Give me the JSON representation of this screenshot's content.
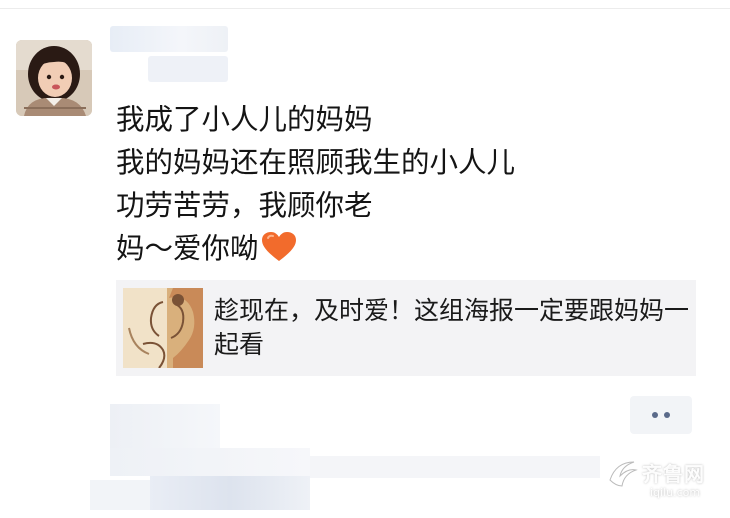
{
  "post": {
    "lines": [
      "我成了小人儿的妈妈",
      "我的妈妈还在照顾我生的小人儿",
      "功劳苦劳，我顾你老",
      "妈～爱你呦"
    ],
    "emoji": "orange-heart-icon"
  },
  "share": {
    "title": "趁现在，及时爱！这组海报一定要跟妈妈一起看",
    "thumbnail": "mother-child-illustration"
  },
  "actions": {
    "more_icon": "ellipsis-icon"
  },
  "watermark": {
    "text": "齐鲁网",
    "sub": "iqilu.com"
  },
  "colors": {
    "heart": "#f26b2c",
    "card_bg": "#f3f3f5",
    "dots": "#5a6a8a"
  }
}
